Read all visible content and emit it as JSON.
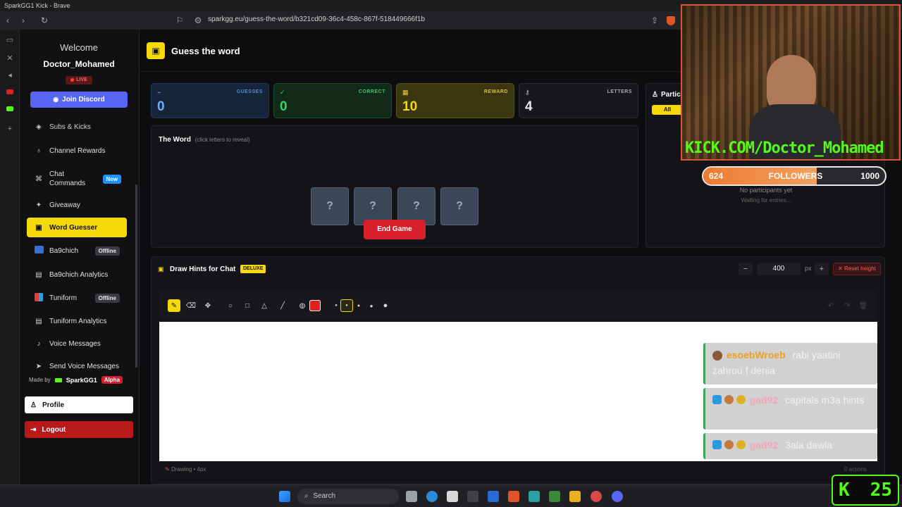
{
  "window": {
    "title": "SparkGG1 Kick - Brave",
    "url": "sparkgg.eu/guess-the-word/b321cd09-36c4-458c-867f-518449666f1b"
  },
  "sidebar": {
    "welcome": "Welcome",
    "username": "Doctor_Mohamed",
    "live_label": "LIVE",
    "discord_button": "Join Discord",
    "items": [
      {
        "label": "Subs & Kicks",
        "icon": "subs-icon"
      },
      {
        "label": "Channel Rewards",
        "icon": "medal-icon"
      },
      {
        "label": "Chat Commands",
        "icon": "command-icon",
        "badge": "New"
      },
      {
        "label": "Giveaway",
        "icon": "gift-icon"
      },
      {
        "label": "Word Guesser",
        "icon": "gamepad-icon",
        "active": true
      },
      {
        "label": "Ba9chich",
        "icon": "ba9chich-icon",
        "badge": "Offline"
      },
      {
        "label": "Ba9chich Analytics",
        "icon": "chart-icon"
      },
      {
        "label": "Tuniform",
        "icon": "tuniform-icon",
        "badge": "Offline"
      },
      {
        "label": "Tuniform Analytics",
        "icon": "chart-icon"
      },
      {
        "label": "Voice Messages",
        "icon": "mic-icon"
      },
      {
        "label": "Send Voice Messages",
        "icon": "send-icon"
      }
    ],
    "made_by": "Made by",
    "brand": "SparkGG1",
    "alpha": "Alpha",
    "profile": "Profile",
    "logout": "Logout"
  },
  "header": {
    "title": "Guess the word"
  },
  "stats": {
    "guesses": {
      "label": "GUESSES",
      "value": "0",
      "color": "#1e3a5f"
    },
    "correct": {
      "label": "CORRECT",
      "value": "0",
      "color": "#123a22"
    },
    "reward": {
      "label": "REWARD",
      "value": "10",
      "color": "#4a4410"
    },
    "letters": {
      "label": "LETTERS",
      "value": "4",
      "color": "#1f1f24"
    }
  },
  "word_panel": {
    "title": "The Word",
    "hint": "(click letters to reveal)",
    "tiles": [
      "?",
      "?",
      "?",
      "?"
    ],
    "end_button": "End Game"
  },
  "participants": {
    "title": "Partic",
    "filter": "All",
    "empty": "No participants yet",
    "waiting": "Waiting for entries..."
  },
  "followers": {
    "current": "624",
    "label": "FOLLOWERS",
    "goal": "1000",
    "progress": 0.624
  },
  "webcam": {
    "overlay_text": "KICK.COM/Doctor_Mohamed"
  },
  "draw": {
    "title": "Draw Hints for Chat",
    "badge": "DELUXE",
    "height_value": "400",
    "unit": "px",
    "reset": "Reset height",
    "status": "Drawing • 4px",
    "actions": "0 actions",
    "brush_color": "#e0201c"
  },
  "chat": [
    {
      "user": "esoebWroeb",
      "user_color": "#f0a020",
      "text": "rabi yaatini zahrou f denia"
    },
    {
      "user": "gad92",
      "user_color": "#f0a8b8",
      "text": "capitals m3a hints"
    },
    {
      "user": "gad92",
      "user_color": "#f0a8b8",
      "text": "3ala dawla"
    }
  ],
  "kick_counter": "25",
  "taskbar": {
    "search": "Search"
  }
}
